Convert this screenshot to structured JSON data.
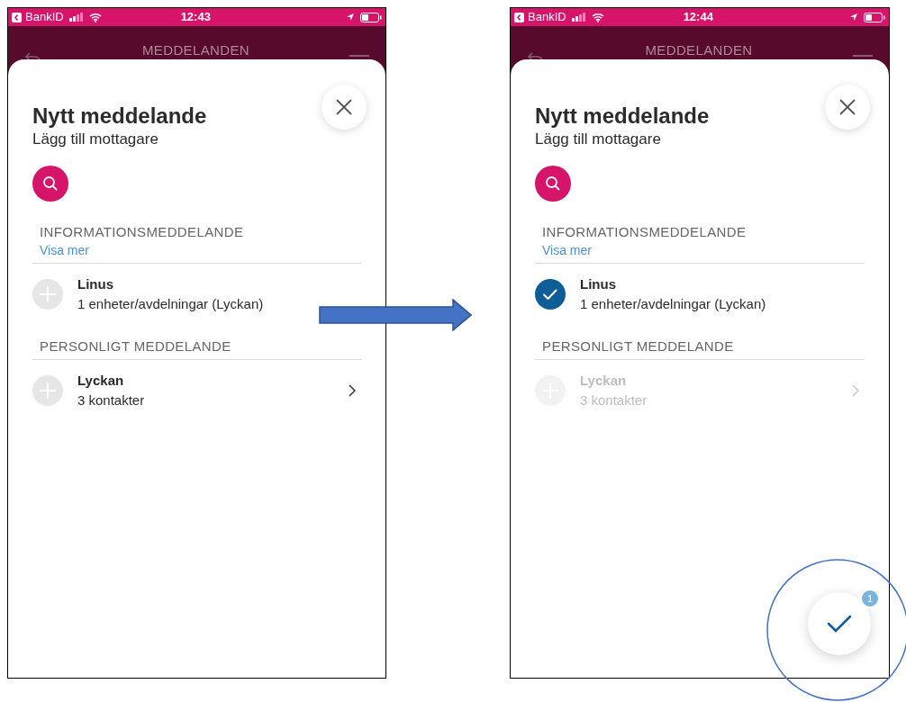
{
  "screens": [
    {
      "status": {
        "carrier": "BankID",
        "time": "12:43"
      },
      "header_title": "MEDDELANDEN",
      "modal": {
        "title": "Nytt meddelande",
        "subtitle": "Lägg till mottagare",
        "sections": [
          {
            "heading": "INFORMATIONSMEDDELANDE",
            "link": "Visa mer",
            "rows": [
              {
                "name": "Linus",
                "detail": "1 enheter/avdelningar (Lyckan)",
                "selected": false,
                "disabled": false,
                "chevron": false
              }
            ]
          },
          {
            "heading": "PERSONLIGT MEDDELANDE",
            "rows": [
              {
                "name": "Lyckan",
                "detail": "3 kontakter",
                "selected": false,
                "disabled": false,
                "chevron": true
              }
            ]
          }
        ]
      }
    },
    {
      "status": {
        "carrier": "BankID",
        "time": "12:44"
      },
      "header_title": "MEDDELANDEN",
      "modal": {
        "title": "Nytt meddelande",
        "subtitle": "Lägg till mottagare",
        "sections": [
          {
            "heading": "INFORMATIONSMEDDELANDE",
            "link": "Visa mer",
            "rows": [
              {
                "name": "Linus",
                "detail": "1 enheter/avdelningar (Lyckan)",
                "selected": true,
                "disabled": false,
                "chevron": false
              }
            ]
          },
          {
            "heading": "PERSONLIGT MEDDELANDE",
            "rows": [
              {
                "name": "Lyckan",
                "detail": "3 kontakter",
                "selected": false,
                "disabled": true,
                "chevron": true
              }
            ]
          }
        ],
        "confirm": {
          "badge": "1"
        }
      }
    }
  ]
}
